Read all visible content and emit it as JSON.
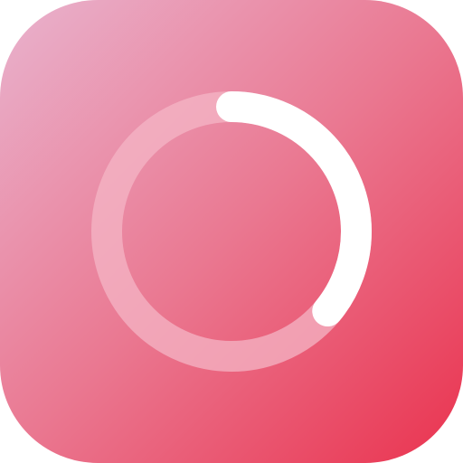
{
  "app_icon": {
    "name": "progress-ring-app",
    "colors": {
      "gradient_start": "#E9B3CE",
      "gradient_mid": "#EA7891",
      "gradient_end": "#EA334F",
      "track": "#F4B6C5",
      "progress": "#FFFFFF"
    }
  },
  "progress_ring": {
    "icon": "progress-ring-icon",
    "progress": 0.36
  }
}
